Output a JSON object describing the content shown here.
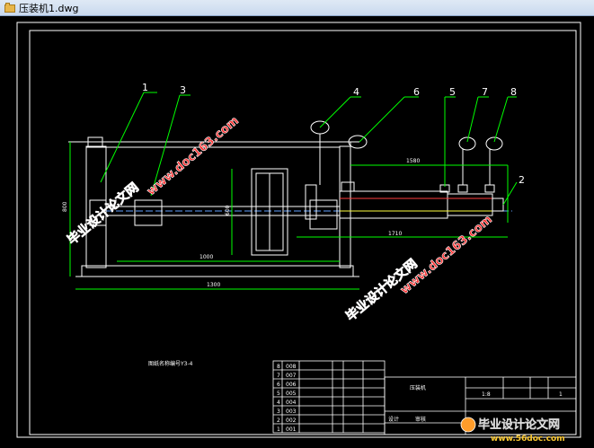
{
  "window": {
    "title": "压装机1.dwg",
    "file_icon": "folder-icon"
  },
  "colors": {
    "background": "#000000",
    "line": "#ffffff",
    "dim": "#00ff00",
    "leader": "#00ff00",
    "watermark": "#ff2020"
  },
  "drawing": {
    "parts": [
      "1",
      "3",
      "4",
      "6",
      "5",
      "7",
      "8",
      "2"
    ],
    "dims": {
      "overall_height": "800",
      "top_span": "1580",
      "lower_span": "1710",
      "inner": "1000",
      "base": "1300",
      "wheel": "600"
    },
    "caption": "图纸名称编号Y3-4",
    "bom_rows": [
      {
        "no": "8",
        "code": "008"
      },
      {
        "no": "7",
        "code": "007"
      },
      {
        "no": "6",
        "code": "006"
      },
      {
        "no": "5",
        "code": "005"
      },
      {
        "no": "4",
        "code": "004"
      },
      {
        "no": "3",
        "code": "003"
      },
      {
        "no": "2",
        "code": "002"
      },
      {
        "no": "1",
        "code": "001"
      }
    ],
    "title_block": {
      "name": "压装机",
      "scale": "1:8",
      "sheet": "1",
      "designer": "设计",
      "reviewer": "审核"
    }
  },
  "watermarks": {
    "text_cn": "毕业设计论文网",
    "text_url": "www.doc163.com",
    "logo_cn": "毕业设计论文网",
    "logo_url": "www.56doc.com"
  }
}
